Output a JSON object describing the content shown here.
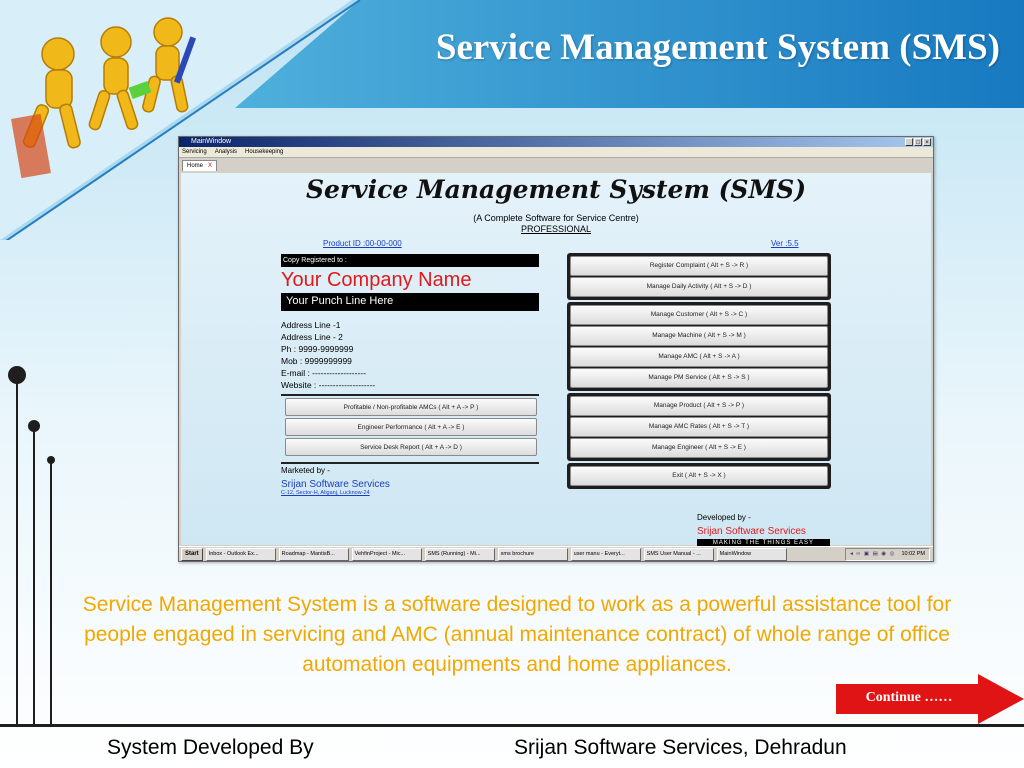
{
  "slide": {
    "title": "Service Management System (SMS)",
    "description": "Service  Management  System  is  a  software designed  to work as a powerful assistance tool for people engaged in servicing and AMC (annual maintenance contract) of whole range  of office automation  equipments and home appliances.",
    "continue_label": "Continue ……",
    "footer_left": "System Developed By",
    "footer_right": "Srijan Software Services, Dehradun",
    "colors": {
      "accent": "#1e88c8",
      "description": "#f2a800",
      "arrow": "#e01414"
    }
  },
  "window": {
    "title": "MainWindow",
    "menu": [
      "Servicing",
      "Analysis",
      "Housekeeping"
    ],
    "tab_label": "Home",
    "tab_close": "X",
    "app_title": "Service Management System (SMS)",
    "subtitle": "(A Complete Software for Service Centre)",
    "edition": "PROFESSIONAL",
    "product_id": "Product ID :00-00-000",
    "version": "Ver :5.5",
    "copy_registered": "Copy Registered to :",
    "company_name": "Your Company Name",
    "punch_line": "Your Punch Line Here",
    "address": [
      "Address Line -1",
      "Address Line - 2",
      "Ph : 9999-9999999",
      "Mob : 9999999999",
      "E-mail : -------------------",
      "Website : --------------------"
    ],
    "left_buttons": [
      "Profitable / Non-profitable AMCs ( Alt + A -> P )",
      "Engineer Performance ( Alt + A -> E )",
      "Service Desk Report ( Alt + A -> D )"
    ],
    "marketed_by_label": "Marketed by -",
    "marketed_by_name": "Srijan Software Services",
    "marketed_by_address": "C-12, Sector-H, Aliganj, Lucknow-24",
    "right_groups": [
      [
        "Register Complaint ( Alt + S -> R )",
        "Manage Daily Activity ( Alt + S -> D )"
      ],
      [
        "Manage Customer ( Alt + S -> C )",
        "Manage Machine ( Alt + S -> M )",
        "Manage AMC ( Alt + S ->  A )",
        "Manage PM Service ( Alt + S -> S )"
      ],
      [
        "Manage Product ( Alt + S -> P )",
        "Manage AMC Rates ( Alt + S -> T )",
        "Manage Engineer ( Alt + S -> E )"
      ],
      [
        "Exit ( Alt + S -> X )"
      ]
    ],
    "developed_by_label": "Developed by -",
    "developed_by_name": "Srijan Software Services",
    "developed_by_tagline": "MAKING THE THINGS EASY"
  },
  "taskbar": {
    "start": "Start",
    "tasks": [
      "Inbox - Outlook Ex...",
      "Roadmap - MantisB...",
      "VehfinProject - Mic...",
      "SMS (Running) - Mi...",
      "sms brochure",
      "user manu - Everyt...",
      "SMS User Manual - ...",
      "MainWindow"
    ],
    "clock": "10:02 PM"
  }
}
